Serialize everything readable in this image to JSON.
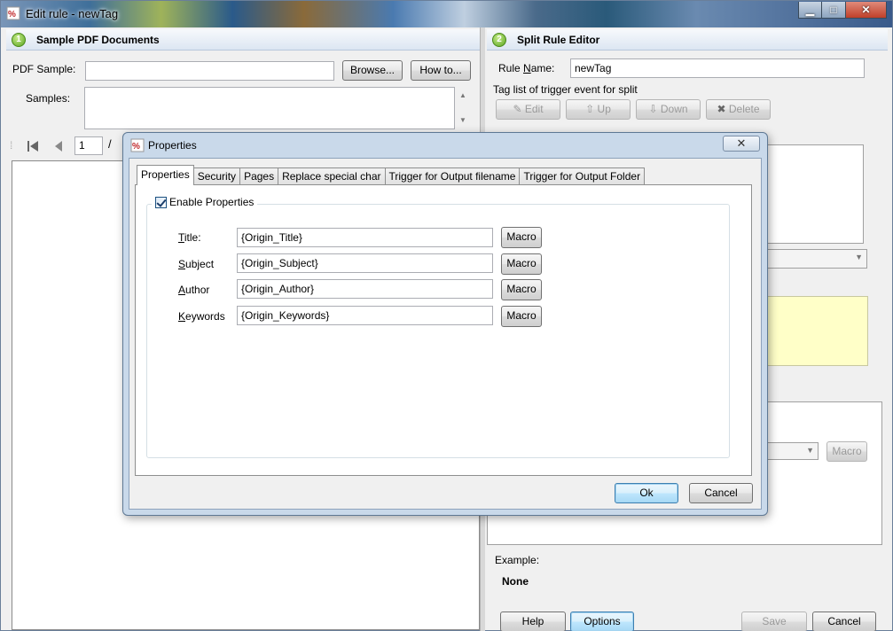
{
  "window": {
    "title": "Edit rule - newTag",
    "controls": {
      "minimize": "▁",
      "maximize": "□",
      "close": "✕"
    }
  },
  "left_panel": {
    "header_num": "1",
    "header": "Sample PDF Documents",
    "pdf_sample_label": "PDF Sample:",
    "pdf_sample_value": "",
    "browse": "Browse...",
    "howto": "How to...",
    "samples_label": "Samples:",
    "page_value": "1",
    "page_sep": "/"
  },
  "right_panel": {
    "header_num": "2",
    "header": "Split Rule Editor",
    "rule_name_label": "Rule Name:",
    "rule_name_value": "newTag",
    "tag_list_label": "Tag list of trigger event for split",
    "edit": "Edit",
    "up": "Up",
    "down": "Down",
    "delete": "Delete",
    "macro": "Macro",
    "example_label": "Example:",
    "example_value": "None",
    "help": "Help",
    "options": "Options",
    "save": "Save",
    "cancel": "Cancel"
  },
  "dialog": {
    "title": "Properties",
    "close": "✕",
    "tabs": [
      "Properties",
      "Security",
      "Pages",
      "Replace special char",
      "Trigger for Output filename",
      "Trigger for Output Folder"
    ],
    "enable_label": "Enable Properties",
    "enable_checked": true,
    "fields": [
      {
        "label_u": "T",
        "label_rest": "itle:",
        "value": "{Origin_Title}"
      },
      {
        "label_u": "S",
        "label_rest": "ubject",
        "value": "{Origin_Subject}"
      },
      {
        "label_u": "A",
        "label_rest": "uthor",
        "value": "{Origin_Author}"
      },
      {
        "label_u": "K",
        "label_rest": "eywords",
        "value": "{Origin_Keywords}"
      }
    ],
    "macro": "Macro",
    "ok": "Ok",
    "cancel": "Cancel"
  }
}
